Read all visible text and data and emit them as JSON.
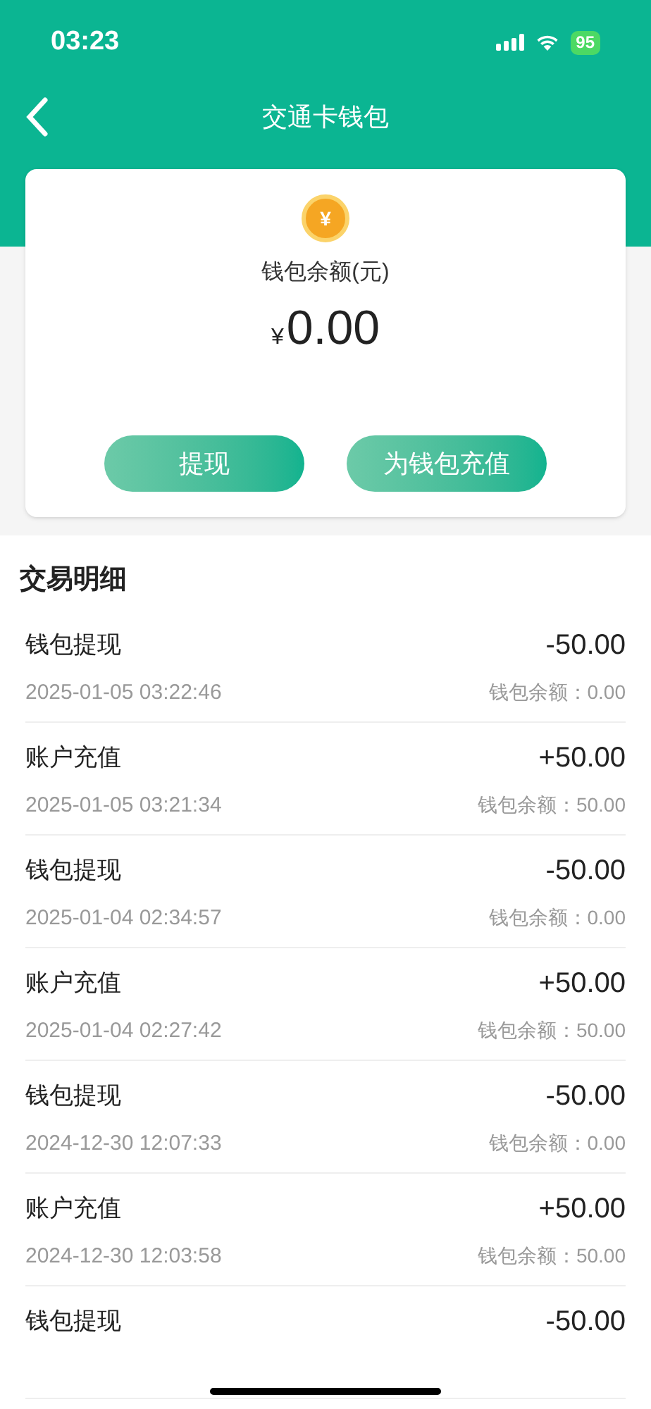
{
  "status_bar": {
    "time": "03:23",
    "battery": "95"
  },
  "nav": {
    "title": "交通卡钱包"
  },
  "wallet": {
    "label": "钱包余额(元)",
    "currency": "¥",
    "amount": "0.00",
    "buttons": [
      "提现",
      "为钱包充值"
    ]
  },
  "transactions": {
    "title": "交易明细",
    "rows": [
      {
        "title": "钱包提现",
        "amount": "-50.00",
        "time": "2025-01-05 03:22:46",
        "balance": "钱包余额：0.00"
      },
      {
        "title": "账户充值",
        "amount": "+50.00",
        "time": "2025-01-05 03:21:34",
        "balance": "钱包余额：50.00"
      },
      {
        "title": "钱包提现",
        "amount": "-50.00",
        "time": "2025-01-04 02:34:57",
        "balance": "钱包余额：0.00"
      },
      {
        "title": "账户充值",
        "amount": "+50.00",
        "time": "2025-01-04 02:27:42",
        "balance": "钱包余额：50.00"
      },
      {
        "title": "钱包提现",
        "amount": "-50.00",
        "time": "2024-12-30 12:07:33",
        "balance": "钱包余额：0.00"
      },
      {
        "title": "账户充值",
        "amount": "+50.00",
        "time": "2024-12-30 12:03:58",
        "balance": "钱包余额：50.00"
      },
      {
        "title": "钱包提现",
        "amount": "-50.00"
      }
    ]
  }
}
